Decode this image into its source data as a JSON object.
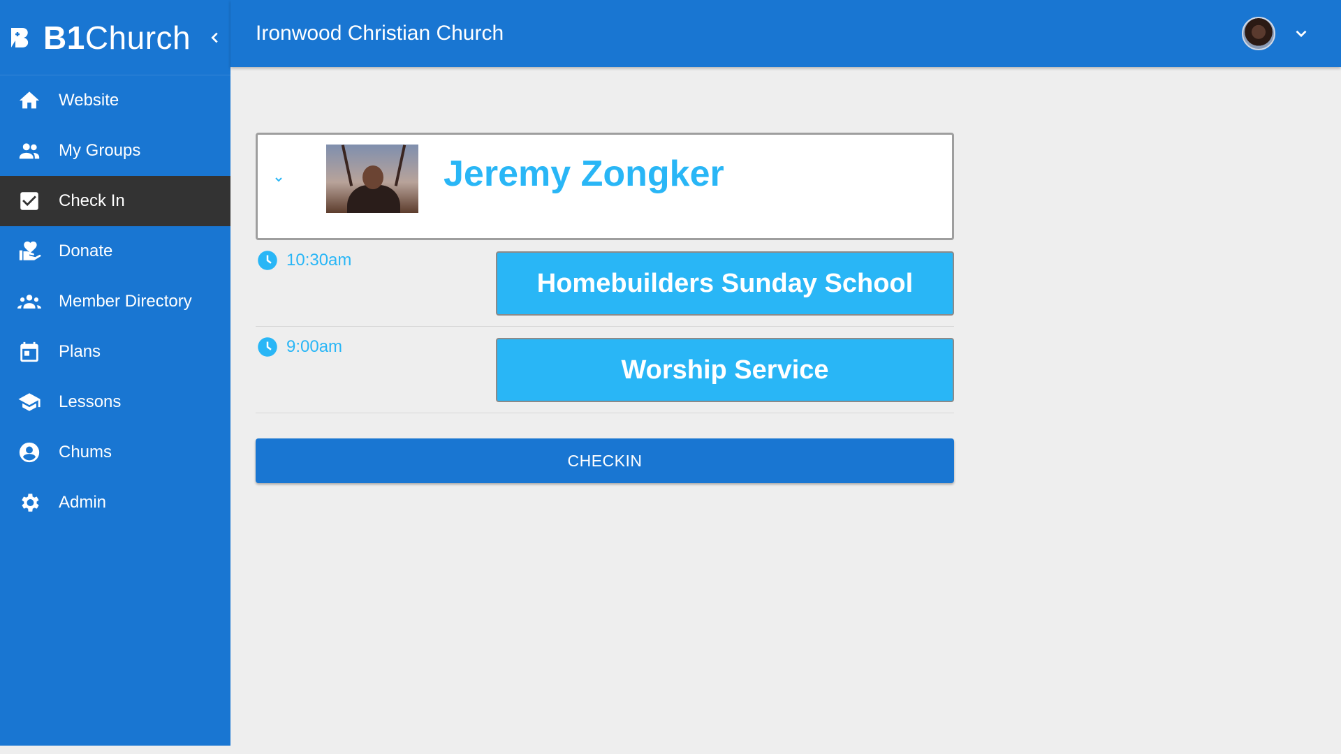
{
  "brand": {
    "bold": "B1",
    "light": "Church"
  },
  "header": {
    "church_name": "Ironwood Christian Church"
  },
  "sidebar": {
    "items": [
      {
        "label": "Website",
        "icon": "home-icon",
        "active": false
      },
      {
        "label": "My Groups",
        "icon": "people-icon",
        "active": false
      },
      {
        "label": "Check In",
        "icon": "check-box-icon",
        "active": true
      },
      {
        "label": "Donate",
        "icon": "volunteer-heart-icon",
        "active": false
      },
      {
        "label": "Member Directory",
        "icon": "groups-icon",
        "active": false
      },
      {
        "label": "Plans",
        "icon": "calendar-icon",
        "active": false
      },
      {
        "label": "Lessons",
        "icon": "school-icon",
        "active": false
      },
      {
        "label": "Chums",
        "icon": "account-circle-icon",
        "active": false
      },
      {
        "label": "Admin",
        "icon": "settings-icon",
        "active": false
      }
    ]
  },
  "person": {
    "name": "Jeremy Zongker"
  },
  "services": [
    {
      "time": "10:30am",
      "group": "Homebuilders Sunday School"
    },
    {
      "time": "9:00am",
      "group": "Worship Service"
    }
  ],
  "checkin_label": "CHECKIN",
  "colors": {
    "primary": "#1976d2",
    "accent": "#29b6f6",
    "active_nav": "#333333",
    "background": "#eeeeee"
  }
}
